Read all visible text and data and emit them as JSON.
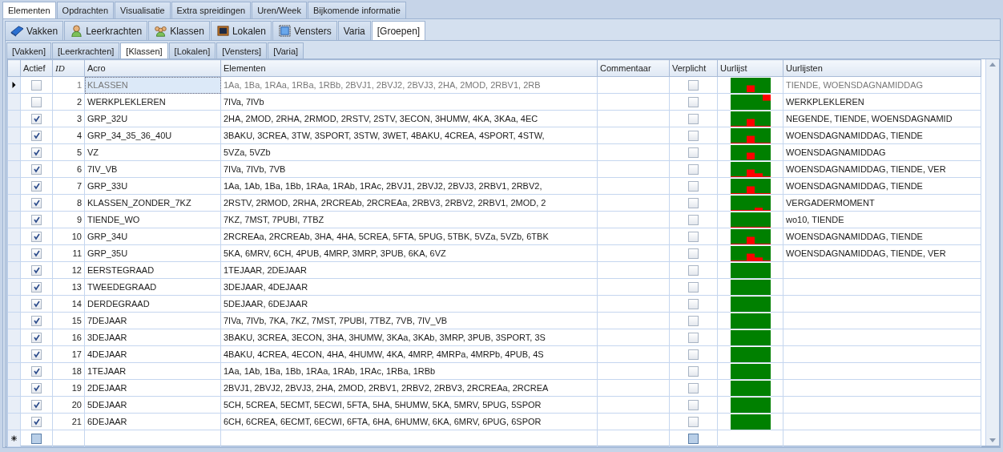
{
  "tabs_main": [
    {
      "label": "Elementen",
      "selected": true
    },
    {
      "label": "Opdrachten",
      "selected": false
    },
    {
      "label": "Visualisatie",
      "selected": false
    },
    {
      "label": "Extra spreidingen",
      "selected": false
    },
    {
      "label": "Uren/Week",
      "selected": false
    },
    {
      "label": "Bijkomende informatie",
      "selected": false
    }
  ],
  "tabs_elements": [
    {
      "label": "Vakken",
      "kind": "book",
      "selected": false
    },
    {
      "label": "Leerkrachten",
      "kind": "person",
      "selected": false
    },
    {
      "label": "Klassen",
      "kind": "people",
      "selected": false
    },
    {
      "label": "Lokalen",
      "kind": "monitor",
      "selected": false
    },
    {
      "label": "Vensters",
      "kind": "window",
      "selected": false
    },
    {
      "label": "Varia",
      "selected": false
    },
    {
      "label": "[Groepen]",
      "selected": true
    }
  ],
  "tabs_groups": [
    {
      "label": "[Vakken]",
      "selected": false
    },
    {
      "label": "[Leerkrachten]",
      "selected": false
    },
    {
      "label": "[Klassen]",
      "selected": true
    },
    {
      "label": "[Lokalen]",
      "selected": false
    },
    {
      "label": "[Vensters]",
      "selected": false
    },
    {
      "label": "[Varia]",
      "selected": false
    }
  ],
  "grid": {
    "columns": [
      "Actief",
      "ID",
      "Acro",
      "Elementen",
      "Commentaar",
      "Verplicht",
      "Uurlijst",
      "Uurlijsten"
    ],
    "rows": [
      {
        "selected": true,
        "actief": false,
        "id": "1",
        "acro": "KLASSEN",
        "elementen": "1Aa, 1Ba, 1RAa, 1RBa, 1RBb, 2BVJ1, 2BVJ2, 2BVJ3, 2HA, 2MOD, 2RBV1, 2RB",
        "verplicht": false,
        "kind": "mid",
        "uurlijsten": "TIENDE, WOENSDAGNAMIDDAG"
      },
      {
        "selected": false,
        "actief": false,
        "id": "2",
        "acro": "WERKPLEKLEREN",
        "elementen": "7IVa, 7IVb",
        "verplicht": false,
        "kind": "corner",
        "uurlijsten": "WERKPLEKLEREN"
      },
      {
        "selected": false,
        "actief": true,
        "id": "3",
        "acro": "GRP_32U",
        "elementen": "2HA, 2MOD, 2RHA, 2RMOD, 2RSTV, 2STV, 3ECON, 3HUMW, 4KA, 3KAa, 4EC",
        "verplicht": false,
        "kind": "midline",
        "uurlijsten": "NEGENDE, TIENDE, WOENSDAGNAMID"
      },
      {
        "selected": false,
        "actief": true,
        "id": "4",
        "acro": "GRP_34_35_36_40U",
        "elementen": "3BAKU, 3CREA, 3TW, 3SPORT, 3STW, 3WET, 4BAKU, 4CREA, 4SPORT, 4STW,",
        "verplicht": false,
        "kind": "midline",
        "uurlijsten": "WOENSDAGNAMIDDAG, TIENDE"
      },
      {
        "selected": false,
        "actief": true,
        "id": "5",
        "acro": "VZ",
        "elementen": "5VZa, 5VZb",
        "verplicht": false,
        "kind": "mid",
        "uurlijsten": "WOENSDAGNAMIDDAG"
      },
      {
        "selected": false,
        "actief": true,
        "id": "6",
        "acro": "7IV_VB",
        "elementen": "7IVa, 7IVb, 7VB",
        "verplicht": false,
        "kind": "stepline",
        "uurlijsten": "WOENSDAGNAMIDDAG, TIENDE, VER"
      },
      {
        "selected": false,
        "actief": true,
        "id": "7",
        "acro": "GRP_33U",
        "elementen": "1Aa, 1Ab, 1Ba, 1Bb, 1RAa, 1RAb, 1RAc, 2BVJ1, 2BVJ2, 2BVJ3, 2RBV1, 2RBV2,",
        "verplicht": false,
        "kind": "midline",
        "uurlijsten": "WOENSDAGNAMIDDAG, TIENDE"
      },
      {
        "selected": false,
        "actief": true,
        "id": "8",
        "acro": "KLASSEN_ZONDER_7KZ",
        "elementen": "2RSTV, 2RMOD, 2RHA, 2RCREAb, 2RCREAa, 2RBV3, 2RBV2, 2RBV1, 2MOD, 2",
        "verplicht": false,
        "kind": "lowline",
        "uurlijsten": "VERGADERMOMENT"
      },
      {
        "selected": false,
        "actief": true,
        "id": "9",
        "acro": "TIENDE_WO",
        "elementen": "7KZ, 7MST, 7PUBI, 7TBZ",
        "verplicht": false,
        "kind": "line",
        "uurlijsten": "wo10, TIENDE"
      },
      {
        "selected": false,
        "actief": true,
        "id": "10",
        "acro": "GRP_34U",
        "elementen": "2RCREAa, 2RCREAb, 3HA, 4HA, 5CREA, 5FTA, 5PUG, 5TBK, 5VZa, 5VZb, 6TBK",
        "verplicht": false,
        "kind": "midline",
        "uurlijsten": "WOENSDAGNAMIDDAG, TIENDE"
      },
      {
        "selected": false,
        "actief": true,
        "id": "11",
        "acro": "GRP_35U",
        "elementen": "5KA, 6MRV, 6CH, 4PUB, 4MRP, 3MRP, 3PUB, 6KA, 6VZ",
        "verplicht": false,
        "kind": "stepline",
        "uurlijsten": "WOENSDAGNAMIDDAG, TIENDE, VER"
      },
      {
        "selected": false,
        "actief": true,
        "id": "12",
        "acro": "EERSTEGRAAD",
        "elementen": "1TEJAAR, 2DEJAAR",
        "verplicht": false,
        "kind": "plain"
      },
      {
        "selected": false,
        "actief": true,
        "id": "13",
        "acro": "TWEEDEGRAAD",
        "elementen": "3DEJAAR, 4DEJAAR",
        "verplicht": false,
        "kind": "plain"
      },
      {
        "selected": false,
        "actief": true,
        "id": "14",
        "acro": "DERDEGRAAD",
        "elementen": "5DEJAAR, 6DEJAAR",
        "verplicht": false,
        "kind": "plain"
      },
      {
        "selected": false,
        "actief": true,
        "id": "15",
        "acro": "7DEJAAR",
        "elementen": "7IVa, 7IVb, 7KA, 7KZ, 7MST, 7PUBI, 7TBZ, 7VB, 7IV_VB",
        "verplicht": false,
        "kind": "plain"
      },
      {
        "selected": false,
        "actief": true,
        "id": "16",
        "acro": "3DEJAAR",
        "elementen": "3BAKU, 3CREA, 3ECON, 3HA, 3HUMW, 3KAa, 3KAb, 3MRP, 3PUB, 3SPORT, 3S",
        "verplicht": false,
        "kind": "plain"
      },
      {
        "selected": false,
        "actief": true,
        "id": "17",
        "acro": "4DEJAAR",
        "elementen": "4BAKU, 4CREA, 4ECON, 4HA, 4HUMW, 4KA, 4MRP, 4MRPa, 4MRPb, 4PUB, 4S",
        "verplicht": false,
        "kind": "plain"
      },
      {
        "selected": false,
        "actief": true,
        "id": "18",
        "acro": "1TEJAAR",
        "elementen": "1Aa, 1Ab, 1Ba, 1Bb, 1RAa, 1RAb, 1RAc, 1RBa, 1RBb",
        "verplicht": false,
        "kind": "plain"
      },
      {
        "selected": false,
        "actief": true,
        "id": "19",
        "acro": "2DEJAAR",
        "elementen": "2BVJ1, 2BVJ2, 2BVJ3, 2HA, 2MOD, 2RBV1, 2RBV2, 2RBV3, 2RCREAa, 2RCREA",
        "verplicht": false,
        "kind": "plain"
      },
      {
        "selected": false,
        "actief": true,
        "id": "20",
        "acro": "5DEJAAR",
        "elementen": "5CH, 5CREA, 5ECMT, 5ECWI, 5FTA, 5HA, 5HUMW, 5KA, 5MRV, 5PUG, 5SPOR",
        "verplicht": false,
        "kind": "plain"
      },
      {
        "selected": false,
        "actief": true,
        "id": "21",
        "acro": "6DEJAAR",
        "elementen": "6CH, 6CREA, 6ECMT, 6ECWI, 6FTA, 6HA, 6HUMW, 6KA, 6MRV, 6PUG, 6SPOR",
        "verplicht": false,
        "kind": "plain"
      }
    ],
    "new_row": {
      "actief_indeterminate": true,
      "verplicht_indeterminate": true
    }
  }
}
